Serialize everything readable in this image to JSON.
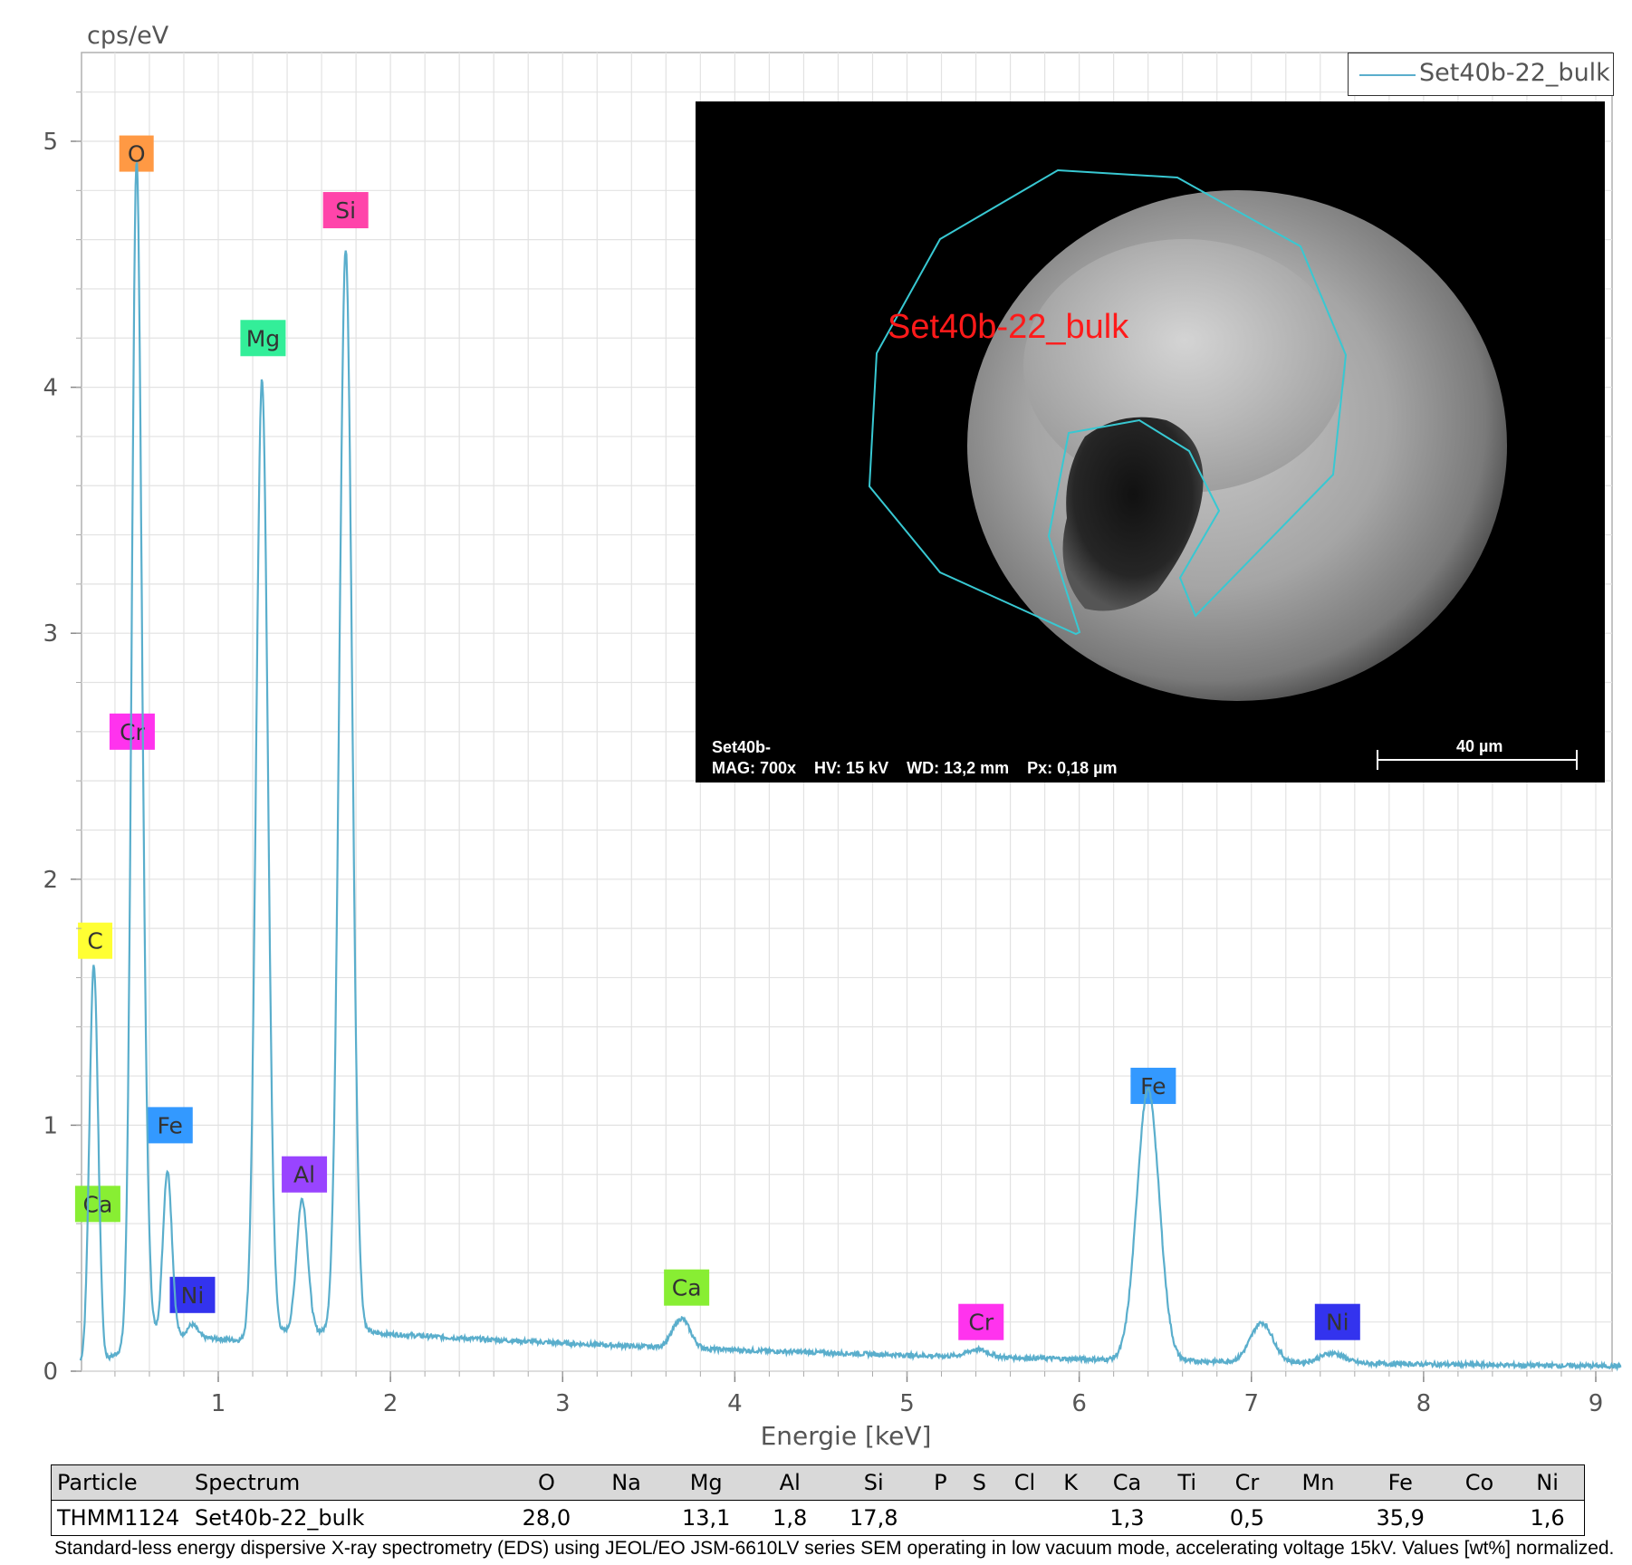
{
  "chart_data": {
    "type": "line",
    "ylabel": "cps/eV",
    "xlabel": "Energie [keV]",
    "xlim": [
      0.2,
      9.15
    ],
    "ylim": [
      0,
      5.4
    ],
    "x_ticks": [
      1,
      2,
      3,
      4,
      5,
      6,
      7,
      8,
      9
    ],
    "y_ticks": [
      0,
      1,
      2,
      3,
      4,
      5
    ],
    "grid": true,
    "series": [
      {
        "name": "Set40b-22_bulk",
        "color": "#5aaecc",
        "peaks": [
          {
            "x": 0.277,
            "y": 1.6,
            "w": 0.025
          },
          {
            "x": 0.525,
            "y": 4.73,
            "w": 0.028
          },
          {
            "x": 0.573,
            "y": 0.55,
            "w": 0.024
          },
          {
            "x": 0.705,
            "y": 0.67,
            "w": 0.026
          },
          {
            "x": 0.85,
            "y": 0.05,
            "w": 0.03
          },
          {
            "x": 1.254,
            "y": 3.87,
            "w": 0.034
          },
          {
            "x": 1.487,
            "y": 0.54,
            "w": 0.032
          },
          {
            "x": 1.74,
            "y": 4.4,
            "w": 0.037
          },
          {
            "x": 3.69,
            "y": 0.12,
            "w": 0.05
          },
          {
            "x": 5.41,
            "y": 0.03,
            "w": 0.06
          },
          {
            "x": 6.4,
            "y": 1.1,
            "w": 0.065
          },
          {
            "x": 7.06,
            "y": 0.16,
            "w": 0.065
          },
          {
            "x": 7.47,
            "y": 0.04,
            "w": 0.07
          }
        ]
      }
    ],
    "legend": "top-right",
    "peak_labels": [
      {
        "text": "O",
        "x": 0.525,
        "y": 4.95,
        "color": "#ff9944"
      },
      {
        "text": "Si",
        "x": 1.74,
        "y": 4.72,
        "color": "#ff44aa"
      },
      {
        "text": "Mg",
        "x": 1.26,
        "y": 4.2,
        "color": "#33ee99"
      },
      {
        "text": "Cr",
        "x": 0.5,
        "y": 2.6,
        "color": "#ff33ee"
      },
      {
        "text": "C",
        "x": 0.285,
        "y": 1.75,
        "color": "#ffff33"
      },
      {
        "text": "Fe",
        "x": 0.72,
        "y": 1.0,
        "color": "#3399ff"
      },
      {
        "text": "Al",
        "x": 1.5,
        "y": 0.8,
        "color": "#9944ff"
      },
      {
        "text": "Ca",
        "x": 0.3,
        "y": 0.68,
        "color": "#88ee33"
      },
      {
        "text": "Ni",
        "x": 0.85,
        "y": 0.31,
        "color": "#3333ee"
      },
      {
        "text": "Ca",
        "x": 3.72,
        "y": 0.34,
        "color": "#88ee33"
      },
      {
        "text": "Cr",
        "x": 5.43,
        "y": 0.2,
        "color": "#ff33ee"
      },
      {
        "text": "Fe",
        "x": 6.43,
        "y": 1.16,
        "color": "#3399ff"
      },
      {
        "text": "Ni",
        "x": 7.5,
        "y": 0.2,
        "color": "#3333ee"
      }
    ]
  },
  "legend_label": "Set40b-22_bulk",
  "sem_image": {
    "label": "Set40b-22_bulk",
    "info_line1": "Set40b-",
    "mag": "MAG: 700x",
    "hv": "HV: 15 kV",
    "wd": "WD: 13,2 mm",
    "px": "Px: 0,18 µm",
    "scale": "40 µm"
  },
  "table": {
    "headers": [
      "Particle",
      "Spectrum",
      "O",
      "Na",
      "Mg",
      "Al",
      "Si",
      "P",
      "S",
      "Cl",
      "K",
      "Ca",
      "Ti",
      "Cr",
      "Mn",
      "Fe",
      "Co",
      "Ni"
    ],
    "row": [
      "THMM1124",
      "Set40b-22_bulk",
      "28,0",
      "",
      "13,1",
      "1,8",
      "17,8",
      "",
      "",
      "",
      "",
      "1,3",
      "",
      "0,5",
      "",
      "35,9",
      "",
      "1,6"
    ]
  },
  "footnote": "Standard-less energy dispersive X-ray spectrometry (EDS) using JEOL/EO JSM-6610LV series SEM operating in low vacuum mode, accelerating voltage 15kV. Values [wt%] normalized."
}
